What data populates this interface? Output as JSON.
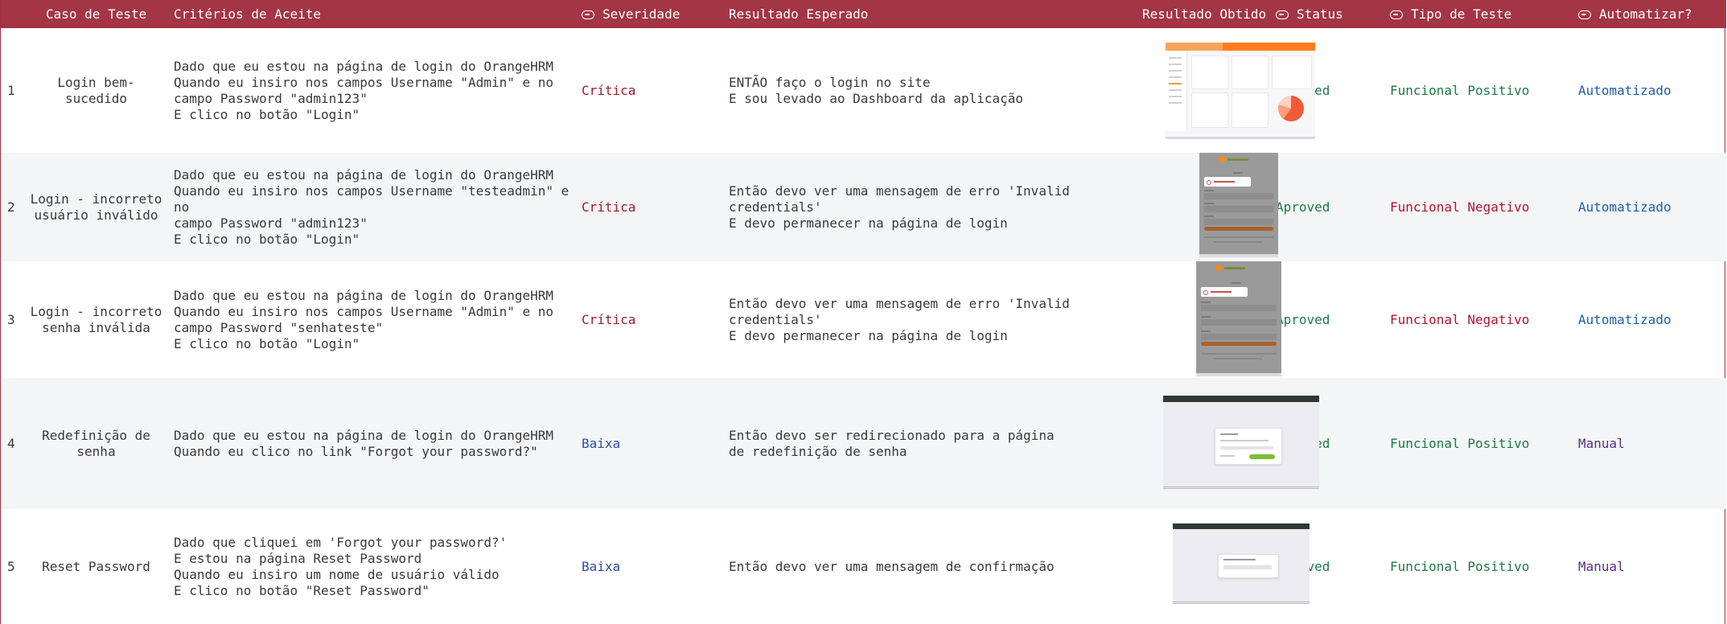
{
  "header": {
    "caso": "Caso de Teste",
    "criterios": "Critérios de Aceite",
    "severidade": "Severidade",
    "resultado_esperado": "Resultado Esperado",
    "resultado_obtido": "Resultado Obtido",
    "status": "Status",
    "tipo": "Tipo de Teste",
    "automatizar": "Automatizar?"
  },
  "rows": [
    {
      "num": "1",
      "caso": "Login bem-\nsucedido",
      "criterios": "Dado que eu estou na página de login do OrangeHRM\nQuando eu insiro nos campos Username \"Admin\" e no\ncampo Password  \"admin123\"\nE clico no botão \"Login\"",
      "severidade": "Crítica",
      "esperado": "ENTÃO faço o login no site\nE sou levado ao Dashboard da aplicação",
      "status": "Aproved",
      "tipo": "Funcional Positivo",
      "automatizar": "Automatizado"
    },
    {
      "num": "2",
      "caso": "Login - incorreto\nusuário inválido",
      "criterios": "Dado que eu estou na página de login do OrangeHRM\nQuando eu insiro nos campos Username \"testeadmin\" e no\ncampo Password  \"admin123\"\nE clico no botão \"Login\"",
      "severidade": "Crítica",
      "esperado": "Então devo ver uma mensagem de erro 'Invalid\ncredentials'\nE devo permanecer na página de login",
      "status": "Aproved",
      "tipo": "Funcional Negativo",
      "automatizar": "Automatizado"
    },
    {
      "num": "3",
      "caso": "Login - incorreto\nsenha inválida",
      "criterios": "Dado que eu estou na página de login do OrangeHRM\nQuando eu insiro nos campos Username \"Admin\" e no\ncampo Password  \"senhateste\"\nE clico no botão \"Login\"",
      "severidade": "Crítica",
      "esperado": "Então devo ver uma mensagem de erro 'Invalid\ncredentials'\nE devo permanecer na página de login",
      "status": "Aproved",
      "tipo": "Funcional Negativo",
      "automatizar": "Automatizado"
    },
    {
      "num": "4",
      "caso": "Redefinição de\nsenha",
      "criterios": "Dado que eu estou na página de login do OrangeHRM\nQuando eu clico no link \"Forgot your password?\"",
      "severidade": "Baixa",
      "esperado": "Então devo ser redirecionado para a página\nde redefinição de senha",
      "status": "Aproved",
      "tipo": "Funcional Positivo",
      "automatizar": "Manual"
    },
    {
      "num": "5",
      "caso": "Reset Password",
      "criterios": "Dado que cliquei em 'Forgot your password?'\nE estou na página Reset Password\nQuando eu insiro um nome de usuário válido\nE clico no botão \"Reset Password\"",
      "severidade": "Baixa",
      "esperado": "Então devo ver uma mensagem de confirmação",
      "status": "Aproved",
      "tipo": "Funcional Positivo",
      "automatizar": "Manual"
    }
  ],
  "colors": {
    "header_bg": "#a33545",
    "critica": "#a11b29",
    "baixa": "#2b4ea6",
    "aproved": "#1e7a44",
    "positivo": "#1e7a44",
    "negativo": "#b3142a",
    "automatizado": "#1f5fa8",
    "manual": "#5a2d87"
  },
  "icons": {
    "select_column": "select-column-icon"
  }
}
